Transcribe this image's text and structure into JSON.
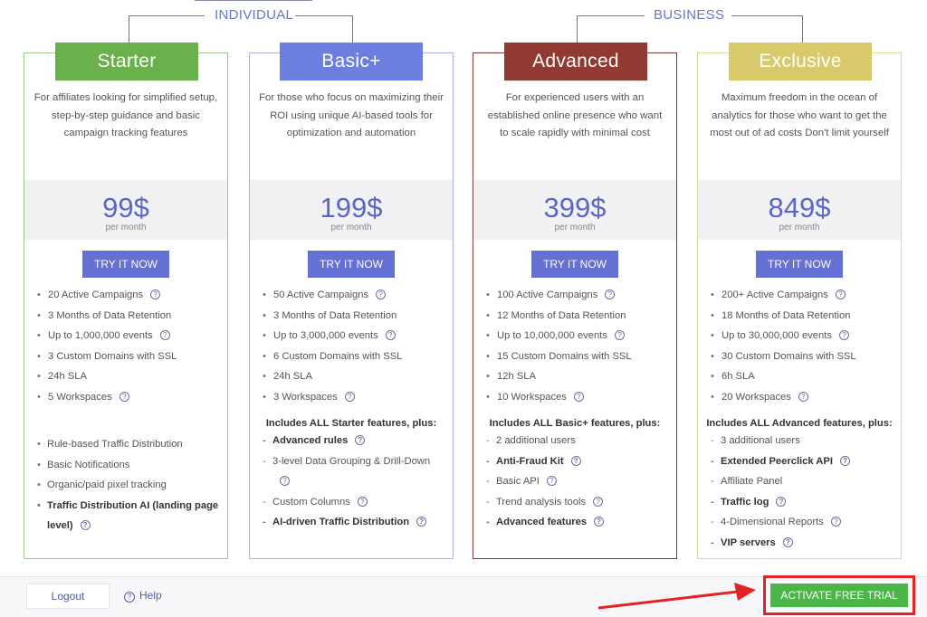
{
  "groups": {
    "individual": "INDIVIDUAL",
    "business": "BUSINESS"
  },
  "colors": {
    "starter": "#6ab04c",
    "basic": "#6c7fe0",
    "advanced": "#913a33",
    "exclusive": "#d8c96a",
    "try_button": "#6470d4",
    "trial_button": "#4bb548",
    "highlight": "#e52222"
  },
  "plans": [
    {
      "name": "Starter",
      "description": "For affiliates looking for simplified setup, step-by-step guidance and basic campaign tracking features",
      "price": "99$",
      "period": "per month",
      "cta": "TRY IT NOW",
      "features": [
        "20 Active Campaigns",
        "3 Months of Data Retention",
        "Up to 1,000,000 events",
        "3 Custom Domains with SSL",
        "24h SLA",
        "5 Workspaces"
      ],
      "includes": "",
      "extras": [
        "Rule-based Traffic Distribution",
        "Basic Notifications",
        "Organic/paid pixel tracking",
        "Traffic Distribution AI (landing page level)"
      ]
    },
    {
      "name": "Basic+",
      "description": "For those who focus on maximizing their ROI using unique AI-based tools for optimization and automation",
      "price": "199$",
      "period": "per month",
      "cta": "TRY IT NOW",
      "features": [
        "50 Active Campaigns",
        "3 Months of Data Retention",
        "Up to 3,000,000 events",
        "6 Custom Domains with SSL",
        "24h SLA",
        "3 Workspaces"
      ],
      "includes": "Includes ALL Starter features, plus:",
      "extras": [
        "Advanced rules",
        "3-level Data Grouping & Drill-Down",
        "Custom Columns",
        "AI-driven Traffic Distribution"
      ]
    },
    {
      "name": "Advanced",
      "description": "For experienced users with an established online presence who want to scale rapidly with minimal cost",
      "price": "399$",
      "period": "per month",
      "cta": "TRY IT NOW",
      "features": [
        "100 Active Campaigns",
        "12 Months of Data Retention",
        "Up to 10,000,000 events",
        "15 Custom Domains with SSL",
        "12h SLA",
        "10 Workspaces"
      ],
      "includes": "Includes ALL Basic+ features, plus:",
      "extras": [
        "2 additional users",
        "Anti-Fraud Kit",
        "Basic API",
        "Trend analysis tools",
        "Advanced features"
      ]
    },
    {
      "name": "Exclusive",
      "description": "Maximum freedom in the ocean of analytics for those who want to get the most out of ad costs  Don't limit yourself",
      "price": "849$",
      "period": "per month",
      "cta": "TRY IT NOW",
      "features": [
        "200+ Active Campaigns",
        "18 Months of Data Retention",
        "Up to 30,000,000 events",
        "30 Custom Domains with SSL",
        "6h SLA",
        "20 Workspaces"
      ],
      "includes": "Includes ALL Advanced features, plus:",
      "extras": [
        "3 additional users",
        "Extended Peerclick API",
        "Affiliate Panel",
        "Traffic log",
        "4-Dimensional Reports",
        "VIP servers"
      ]
    }
  ],
  "footer": {
    "logout": "Logout",
    "help": "Help",
    "activate": "ACTIVATE FREE TRIAL"
  }
}
